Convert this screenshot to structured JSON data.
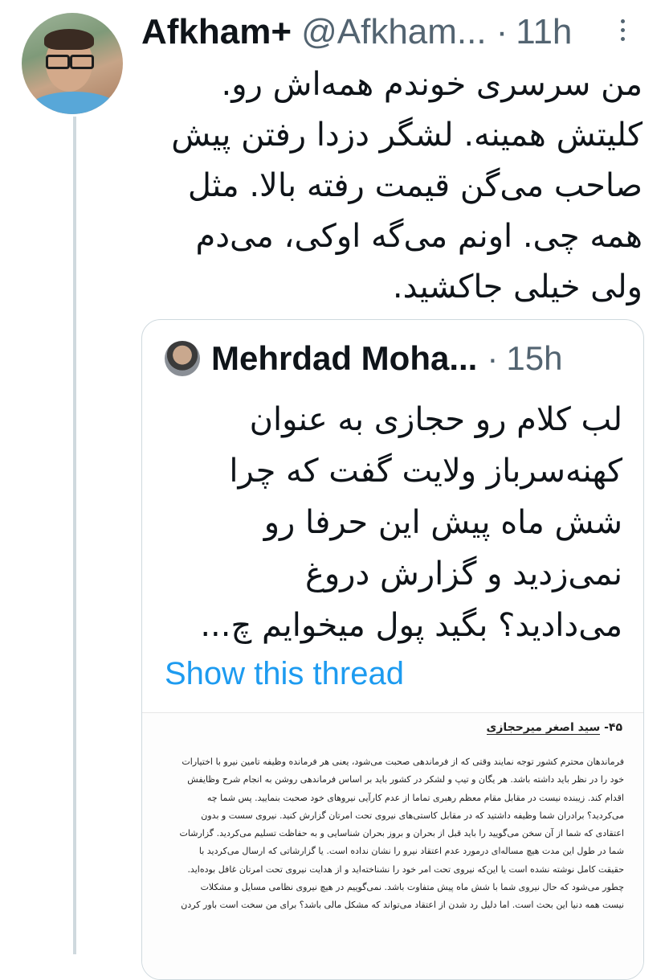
{
  "tweet": {
    "author_name": "Afkham+",
    "author_handle": "@Afkham...",
    "separator": "·",
    "time": "11h",
    "text": "من سرسری خوندم همه‌اش رو. کلیتش همینه. لشگر دزدا رفتن پیش صاحب می‌گن قیمت رفته بالا. مثل همه چی. اونم می‌گه اوکی، می‌دم ولی خیلی جاکشید."
  },
  "quoted_tweet": {
    "author_name": "Mehrdad Moha...",
    "separator": "·",
    "time": "15h",
    "text": "لب کلام رو حجازی به عنوان کهنه‌سرباز ولایت گفت که چرا شش ماه پیش این حرفا رو نمی‌زدید و گزارش دروغ می‌دادید؟ بگید پول میخوایم چ...",
    "show_thread_label": "Show this thread"
  },
  "attachment": {
    "number": "۴۵-",
    "heading": "سید اصغر میرحجازی",
    "lines": [
      "فرماندهان محترم کشور توجه نمایند وقتی که از فرماندهی صحبت می‌شود، یعنی هر فرمانده وظیفه تامین نیرو با اختیارات",
      "خود را در نظر باید داشته باشد. هر یگان و تیپ و لشکر در کشور باید بر اساس فرماندهی روشن به انجام شرح وظایفش",
      "اقدام کند. زیبنده نیست در مقابل مقام معظم رهبری تماما از عدم کارآیی نیروهای خود صحبت بنمایید. پس شما چه",
      "می‌کردید؟ برادران شما وظیفه داشتید که در مقابل کاستی‌های نیروی تحت امرتان گزارش کنید. نیروی سست و بدون",
      "اعتقادی که شما از آن سخن می‌گویید را باید قبل از بحران و بروز بحران شناسایی و به حفاظت تسلیم می‌کردید. گزارشات",
      "شما در طول این مدت هیچ مساله‌ای درمورد عدم اعتقاد نیرو را نشان نداده است. یا گزارشاتی که ارسال می‌کردید با",
      "حقیقت کامل نوشته نشده است یا این‌که نیروی تحت امر خود را نشناخته‌اید و از هدایت نیروی تحت امرتان غافل بوده‌اید.",
      "چطور می‌شود که حال نیروی شما با شش ماه پیش متفاوت باشد. نمی‌گوییم در هیچ نیروی نظامی مسایل و مشکلات",
      "نیست همه دنیا این بحث است. اما دلیل رد شدن از اعتقاد می‌تواند که مشکل مالی باشد؟ برای من سخت است باور کردن"
    ]
  }
}
